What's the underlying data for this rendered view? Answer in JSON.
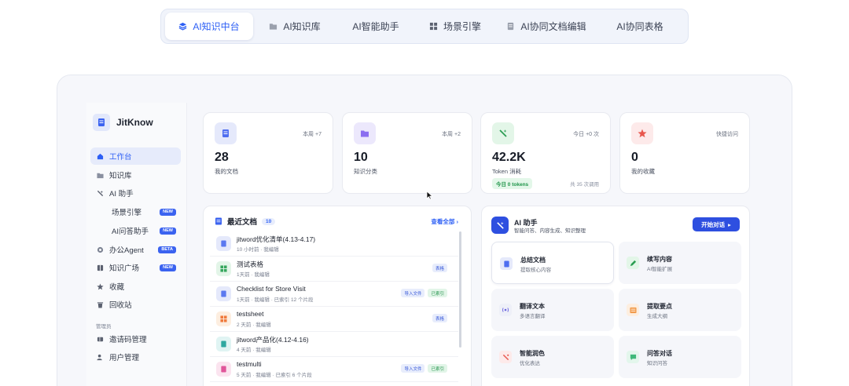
{
  "top_tabs": [
    {
      "label": "AI知识中台",
      "icon": "layers-icon",
      "active": true
    },
    {
      "label": "AI知识库",
      "icon": "folder-icon",
      "active": false
    },
    {
      "label": "AI智能助手",
      "icon": "",
      "active": false
    },
    {
      "label": "场景引擎",
      "icon": "grid-icon",
      "active": false
    },
    {
      "label": "AI协同文档编辑",
      "icon": "document-icon",
      "active": false
    },
    {
      "label": "AI协同表格",
      "icon": "",
      "active": false
    }
  ],
  "sidebar": {
    "brand": "JitKnow",
    "items": [
      {
        "label": "工作台",
        "icon": "home-icon",
        "active": true
      },
      {
        "label": "知识库",
        "icon": "folder-icon"
      },
      {
        "label": "AI 助手",
        "icon": "wand-icon"
      },
      {
        "label": "场景引擎",
        "badge": "NEW",
        "sub": true
      },
      {
        "label": "AI问答助手",
        "badge": "NEW",
        "sub": true
      },
      {
        "label": "办公Agent",
        "icon": "agent-icon",
        "badge": "BETA"
      },
      {
        "label": "知识广场",
        "icon": "book-icon",
        "badge": "NEW"
      },
      {
        "label": "收藏",
        "icon": "star-icon"
      },
      {
        "label": "回收站",
        "icon": "trash-icon"
      }
    ],
    "admin_group": "管理员",
    "admin_items": [
      {
        "label": "邀请码管理",
        "icon": "ticket-icon"
      },
      {
        "label": "用户管理",
        "icon": "users-icon"
      }
    ]
  },
  "stats": [
    {
      "value": "28",
      "label": "我的文档",
      "tag": "本周 +7",
      "icon": "document-icon"
    },
    {
      "value": "10",
      "label": "知识分类",
      "tag": "本周 +2",
      "icon": "folder-icon"
    },
    {
      "value": "42.2K",
      "label": "Token 消耗",
      "tag": "今日 +0 次",
      "icon": "wand-icon",
      "pill": "今日 0 tokens",
      "sub": "共 35 次调用"
    },
    {
      "value": "0",
      "label": "我的收藏",
      "tag": "快捷访问",
      "icon": "star-icon"
    }
  ],
  "recent": {
    "title": "最近文档",
    "count": "10",
    "view_all": "查看全部",
    "docs": [
      {
        "title": "jitword优化清单(4.13-4.17)",
        "meta": "10 小时前 · 我编辑",
        "tags": [],
        "icon": "document-icon"
      },
      {
        "title": "测试表格",
        "meta": "1天前 · 我编辑",
        "tags": [
          {
            "text": "表格",
            "color": "blue"
          }
        ],
        "icon": "sheet-icon"
      },
      {
        "title": "Checklist for Store Visit",
        "meta": "1天前 · 我编辑 · 已索引 12 个片段",
        "tags": [
          {
            "text": "导入文件",
            "color": "blue"
          },
          {
            "text": "已索引",
            "color": "green"
          }
        ],
        "icon": "document-icon"
      },
      {
        "title": "testsheet",
        "meta": "2 天前 · 我编辑",
        "tags": [
          {
            "text": "表格",
            "color": "blue"
          }
        ],
        "icon": "sheet-icon"
      },
      {
        "title": "jitword产品化(4.12-4.16)",
        "meta": "4 天前 · 我编辑",
        "tags": [],
        "icon": "document-icon"
      },
      {
        "title": "testmulti",
        "meta": "5 天前 · 我编辑 · 已索引 6 个片段",
        "tags": [
          {
            "text": "导入文件",
            "color": "blue"
          },
          {
            "text": "已索引",
            "color": "green"
          }
        ],
        "icon": "document-icon"
      }
    ]
  },
  "ai": {
    "title": "AI 助手",
    "subtitle": "智能问答、内容生成、知识整理",
    "start_button": "开始对话",
    "tiles": [
      {
        "title": "总结文档",
        "sub": "提取核心内容",
        "icon": "summary-icon"
      },
      {
        "title": "续写内容",
        "sub": "AI智能扩展",
        "icon": "pen-icon"
      },
      {
        "title": "翻译文本",
        "sub": "多语言翻译",
        "icon": "translate-icon"
      },
      {
        "title": "提取要点",
        "sub": "生成大纲",
        "icon": "list-icon"
      },
      {
        "title": "智能润色",
        "sub": "优化表达",
        "icon": "polish-icon"
      },
      {
        "title": "问答对话",
        "sub": "知识问答",
        "icon": "chat-icon"
      }
    ]
  },
  "colors": {
    "accent": "#2d5ff5",
    "button": "#2e4fe0",
    "badge_new": "#3b63f0",
    "success": "#23934b"
  }
}
